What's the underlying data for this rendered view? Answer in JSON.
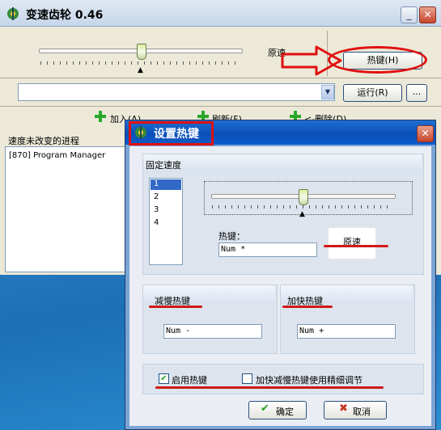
{
  "main_window": {
    "title": "变速齿轮 0.46",
    "speed_label": "原速",
    "hotkey_button": "热键(H)",
    "run_button": "运行(R)",
    "more_button": "...",
    "toolbar": {
      "add_label": "加入(A)...",
      "refresh_label": "刷新(F)",
      "remove_label": "<-删除(D)"
    },
    "process_list_header": "速度未改变的进程",
    "processes": [
      "[870]  Program Manager"
    ]
  },
  "dialog": {
    "title": "设置热键",
    "fixed_speed_label": "固定速度",
    "speed_items": [
      "1",
      "2",
      "3",
      "4"
    ],
    "selected_index": 0,
    "hotkey_label": "热键：",
    "hotkey_value": "Num *",
    "original_speed_button": "原速",
    "slow_down_label": "减慢热键",
    "slow_down_value": "Num -",
    "speed_up_label": "加快热键",
    "speed_up_value": "Num +",
    "enable_hotkey_label": "启用热键",
    "enable_hotkey_checked": true,
    "fine_tune_label": "加快减慢热键使用精细调节",
    "fine_tune_checked": false,
    "ok_button": "确定",
    "cancel_button": "取消"
  },
  "colors": {
    "annotation_red": "#e01010",
    "dialog_title_bar": "#0a4fb8",
    "ok_green": "#21a121",
    "cancel_red": "#c8321e"
  }
}
